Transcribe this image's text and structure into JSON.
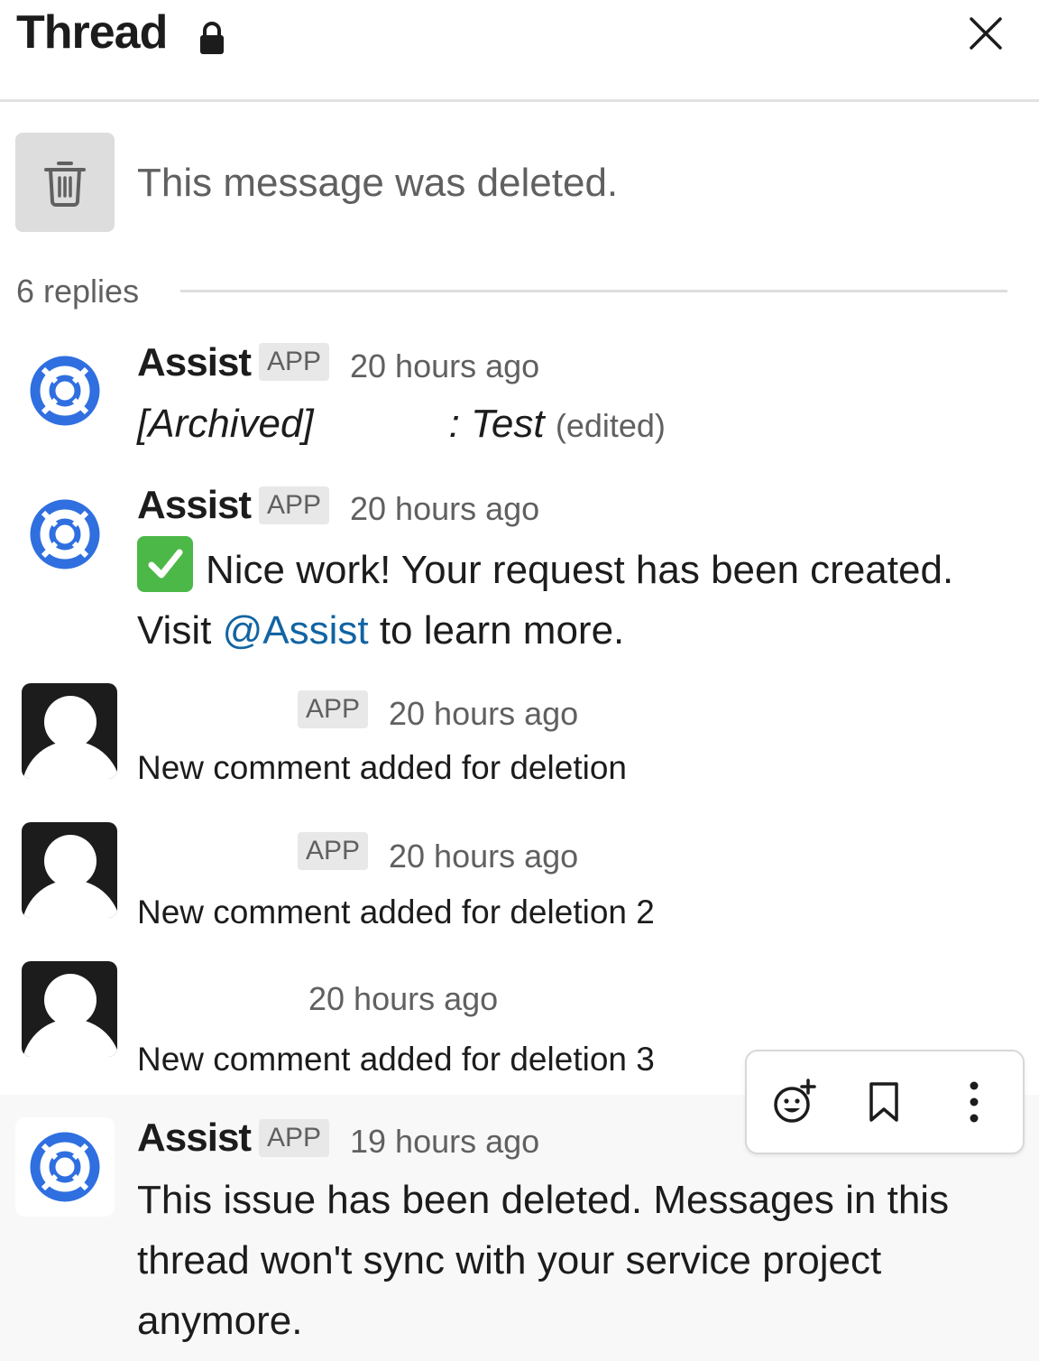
{
  "header": {
    "title": "Thread",
    "lock_icon": "lock-icon",
    "close_icon": "close-icon"
  },
  "parent": {
    "icon": "trash-icon",
    "text": "This message was deleted."
  },
  "replies_label": "6 replies",
  "messages": [
    {
      "sender": "Assist",
      "badge": "APP",
      "time": "20 hours ago",
      "prefix": "[Archived]",
      "text": ": Test",
      "edited": "(edited)"
    },
    {
      "sender": "Assist",
      "badge": "APP",
      "time": "20 hours ago",
      "text": "Nice work! Your request has been created.",
      "text2_pre": "Visit",
      "mention": "@Assist",
      "text2_post": "to learn more."
    },
    {
      "badge": "APP",
      "time": "20 hours ago",
      "text": "New comment added for deletion"
    },
    {
      "badge": "APP",
      "time": "20 hours ago",
      "text": "New comment added for deletion 2"
    },
    {
      "time": "20 hours ago",
      "text": "New comment added for deletion 3"
    },
    {
      "sender": "Assist",
      "badge": "APP",
      "time": "19 hours ago",
      "text": "This issue has been deleted. Messages in this",
      "text2": "thread won't sync with your service project",
      "text3": "anymore."
    }
  ],
  "toolbar": {
    "icons": [
      "add-reaction-icon",
      "bookmark-icon",
      "more-actions-icon"
    ]
  },
  "colors": {
    "mention": "#1264a3",
    "app_icon": "#2f6fe0",
    "check": "#4cb848"
  }
}
